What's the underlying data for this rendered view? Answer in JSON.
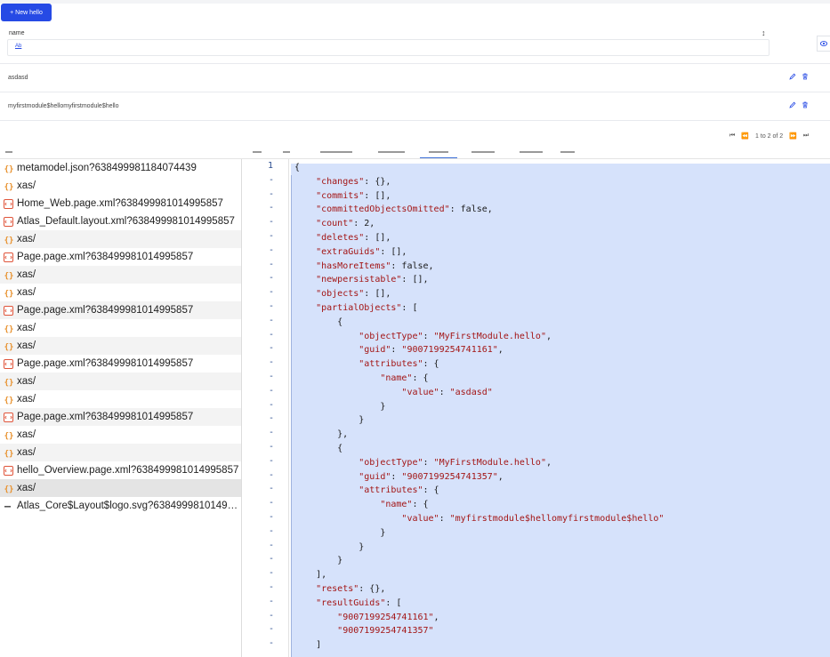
{
  "app": {
    "new_button": "+ New hello",
    "filter_label": "name",
    "filter_type": "Ab",
    "rows": [
      {
        "name": "asdasd"
      },
      {
        "name": "myfirstmodule$hellomyfirstmodule$hello"
      }
    ],
    "pager_text": "1 to 2 of 2"
  },
  "requests": [
    {
      "icon": "json-icon",
      "name": "metamodel.json?638499981184074439",
      "style": ""
    },
    {
      "icon": "json-icon",
      "name": "xas/",
      "style": ""
    },
    {
      "icon": "document-icon",
      "name": "Home_Web.page.xml?638499981014995857",
      "style": ""
    },
    {
      "icon": "document-icon",
      "name": "Atlas_Default.layout.xml?638499981014995857",
      "style": ""
    },
    {
      "icon": "json-icon",
      "name": "xas/",
      "style": "alt"
    },
    {
      "icon": "document-icon",
      "name": "Page.page.xml?638499981014995857",
      "style": ""
    },
    {
      "icon": "json-icon",
      "name": "xas/",
      "style": "alt"
    },
    {
      "icon": "json-icon",
      "name": "xas/",
      "style": ""
    },
    {
      "icon": "document-icon",
      "name": "Page.page.xml?638499981014995857",
      "style": "alt"
    },
    {
      "icon": "json-icon",
      "name": "xas/",
      "style": ""
    },
    {
      "icon": "json-icon",
      "name": "xas/",
      "style": "alt"
    },
    {
      "icon": "document-icon",
      "name": "Page.page.xml?638499981014995857",
      "style": ""
    },
    {
      "icon": "json-icon",
      "name": "xas/",
      "style": "alt"
    },
    {
      "icon": "json-icon",
      "name": "xas/",
      "style": ""
    },
    {
      "icon": "document-icon",
      "name": "Page.page.xml?638499981014995857",
      "style": "alt"
    },
    {
      "icon": "json-icon",
      "name": "xas/",
      "style": ""
    },
    {
      "icon": "json-icon",
      "name": "xas/",
      "style": "alt"
    },
    {
      "icon": "document-icon",
      "name": "hello_Overview.page.xml?638499981014995857",
      "style": ""
    },
    {
      "icon": "json-icon",
      "name": "xas/",
      "style": "sel"
    },
    {
      "icon": "image-icon",
      "name": "Atlas_Core$Layout$logo.svg?63849998101499...",
      "style": ""
    }
  ],
  "gutter": [
    "1",
    "-",
    "-",
    "-",
    "-",
    "-",
    "-",
    "-",
    "-",
    "-",
    "-",
    "-",
    "-",
    "-",
    "-",
    "-",
    "-",
    "-",
    "-",
    "-",
    "-",
    "-",
    "-",
    "-",
    "-",
    "-",
    "-",
    "-",
    "-",
    "-",
    "-",
    "-",
    "-",
    "-",
    "-",
    "-",
    "-",
    "-",
    "-",
    "-",
    "-",
    "-",
    "-",
    "-",
    "-",
    "-"
  ],
  "code_lines": [
    "{",
    "    \"changes\": {},",
    "    \"commits\": [],",
    "    \"committedObjectsOmitted\": false,",
    "    \"count\": 2,",
    "    \"deletes\": [],",
    "    \"extraGuids\": [],",
    "    \"hasMoreItems\": false,",
    "    \"newpersistable\": [],",
    "    \"objects\": [],",
    "    \"partialObjects\": [",
    "        {",
    "            \"objectType\": \"MyFirstModule.hello\",",
    "            \"guid\": \"9007199254741161\",",
    "            \"attributes\": {",
    "                \"name\": {",
    "                    \"value\": \"asdasd\"",
    "                }",
    "            }",
    "        },",
    "        {",
    "            \"objectType\": \"MyFirstModule.hello\",",
    "            \"guid\": \"9007199254741357\",",
    "            \"attributes\": {",
    "                \"name\": {",
    "                    \"value\": \"myfirstmodule$hellomyfirstmodule$hello\"",
    "                }",
    "            }",
    "        }",
    "    ],",
    "    \"resets\": {},",
    "    \"resultGuids\": [",
    "        \"9007199254741161\",",
    "        \"9007199254741357\"",
    "    ]"
  ],
  "colors": {
    "accent": "#264ae5",
    "selection": "#d6e2fb",
    "json_icon": "#e8912d",
    "doc_icon": "#e0553b"
  }
}
